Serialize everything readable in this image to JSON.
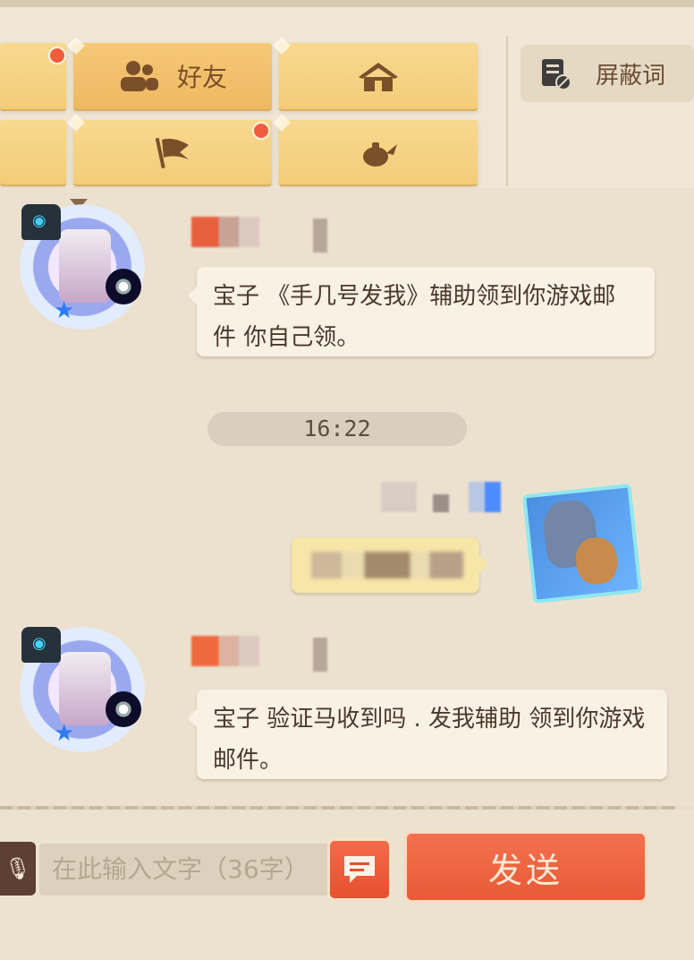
{
  "tabs": {
    "friends_label": "好友",
    "blocked_words_label": "屏蔽词"
  },
  "chat": {
    "time_divider": "16:22",
    "messages": [
      {
        "text": "宝子 《手几号发我》辅助领到你游戏邮件 你自己领。"
      },
      {
        "text": "宝子  验证马收到吗 . 发我辅助 领到你游戏邮件。"
      }
    ]
  },
  "input": {
    "placeholder": "在此输入文字（36字）",
    "send_label": "发送"
  },
  "colors": {
    "tab_yellow": "#f3cc78",
    "send_orange": "#e75a36",
    "badge_red": "#f25b3c"
  }
}
